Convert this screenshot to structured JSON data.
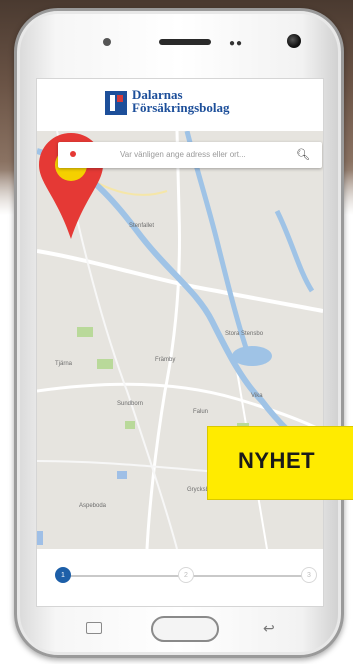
{
  "logo": {
    "line1": "Dalarnas",
    "line2": "Försäkringsbolag"
  },
  "search": {
    "placeholder": "Var vänligen ange adress eller ort..."
  },
  "map": {
    "labels": [
      {
        "text": "Stenfallet"
      },
      {
        "text": "Tjärna"
      },
      {
        "text": "Främby"
      },
      {
        "text": "Stora Stensbo"
      },
      {
        "text": "Sundborn"
      },
      {
        "text": "Falun"
      },
      {
        "text": "Vika"
      },
      {
        "text": "Aspeboda"
      },
      {
        "text": "Grycksbo"
      }
    ]
  },
  "banner": {
    "text": "NYHET"
  },
  "stepper": {
    "steps": [
      "1",
      "2",
      "3"
    ],
    "active_step": 1
  },
  "colors": {
    "brand_blue": "#1d4f9a",
    "pin_red": "#e53935",
    "pin_yellow": "#f5d000",
    "banner_yellow": "#ffeb00"
  }
}
